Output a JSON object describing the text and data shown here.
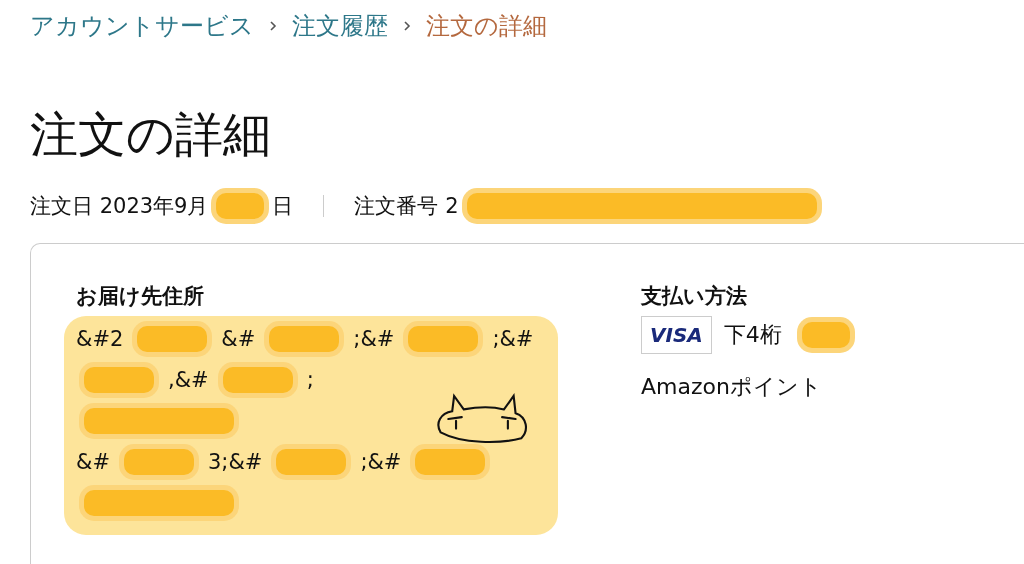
{
  "breadcrumb": [
    {
      "label": "アカウントサービス",
      "current": false
    },
    {
      "label": "注文履歴",
      "current": false
    },
    {
      "label": "注文の詳細",
      "current": true
    }
  ],
  "title": "注文の詳細",
  "order_meta": [
    {
      "segments": [
        {
          "kind": "text",
          "text": "注文日 2023年9月"
        },
        {
          "kind": "redacted"
        },
        {
          "kind": "text",
          "text": "日"
        }
      ]
    },
    {
      "segments": [
        {
          "kind": "text",
          "text": "注文番号 2"
        },
        {
          "kind": "redacted_long"
        }
      ]
    }
  ],
  "shipping_address": {
    "heading": "お届け先住所",
    "lines": [
      {
        "segments": [
          {
            "kind": "text",
            "text": "&#2"
          },
          {
            "kind": "redacted"
          },
          {
            "kind": "text",
            "text": "&#"
          },
          {
            "kind": "redacted"
          },
          {
            "kind": "text",
            "text": ";&#"
          },
          {
            "kind": "redacted"
          },
          {
            "kind": "text",
            "text": ";&#"
          }
        ]
      },
      {
        "segments": [
          {
            "kind": "redacted"
          },
          {
            "kind": "text",
            "text": ",&#"
          },
          {
            "kind": "redacted"
          },
          {
            "kind": "text",
            "text": ";"
          }
        ]
      },
      {
        "segments": [
          {
            "kind": "redacted"
          }
        ]
      },
      {
        "segments": [
          {
            "kind": "text",
            "text": "&#"
          },
          {
            "kind": "redacted"
          },
          {
            "kind": "text",
            "text": "3;&#"
          },
          {
            "kind": "redacted"
          },
          {
            "kind": "text",
            "text": ";&#"
          },
          {
            "kind": "redacted"
          }
        ]
      },
      {
        "segments": [
          {
            "kind": "redacted"
          }
        ]
      }
    ]
  },
  "payment_method": {
    "heading": "支払い方法",
    "card_brand": "VISA",
    "card_label": "下4桁",
    "points": "Amazonポイント"
  }
}
